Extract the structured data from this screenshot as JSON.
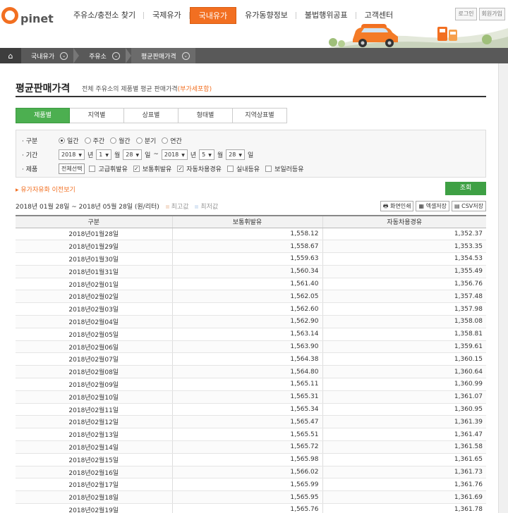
{
  "logo": {
    "text": "pinet"
  },
  "gnb": [
    "주유소/충전소 찾기",
    "국제유가",
    "국내유가",
    "유가동향정보",
    "불법행위공표",
    "고객센터"
  ],
  "util": {
    "login": "로그인",
    "join": "회원가입"
  },
  "breadcrumb": {
    "items": [
      "국내유가",
      "주유소",
      "평균판매가격"
    ]
  },
  "page": {
    "title": "평균판매가격",
    "desc": "전체 주유소의 제품별 평균 판매가격",
    "vat": "(부가세포함)"
  },
  "tabs": [
    "제품별",
    "지역별",
    "상표별",
    "형태별",
    "지역상표별"
  ],
  "search": {
    "row1_label": "구분",
    "period_options": [
      "일간",
      "주간",
      "월간",
      "분기",
      "연간"
    ],
    "row2_label": "기간",
    "start": {
      "year": "2018",
      "month": "1",
      "day": "28"
    },
    "end": {
      "year": "2018",
      "month": "5",
      "day": "28"
    },
    "units": {
      "y": "년",
      "m": "월",
      "d": "일",
      "tilde": "~"
    },
    "row3_label": "제품",
    "select_all": "전체선택",
    "products": [
      {
        "label": "고급휘발유",
        "checked": false
      },
      {
        "label": "보통휘발유",
        "checked": true
      },
      {
        "label": "자동차용경유",
        "checked": true
      },
      {
        "label": "실내등유",
        "checked": false
      },
      {
        "label": "보일러등유",
        "checked": false
      }
    ]
  },
  "history_link": "유가자유화 이전보기",
  "query_button": "조회",
  "range_text": "2018년 01월 28일 ~ 2018년 05월 28일 (원/리터)",
  "legend": {
    "max": "최고값",
    "min": "최저값"
  },
  "export": {
    "print": "화면인쇄",
    "excel": "엑셀저장",
    "csv": "CSV저장"
  },
  "table": {
    "headers": [
      "구분",
      "보통휘발유",
      "자동차용경유"
    ],
    "rows": [
      [
        "2018년01월28일",
        "1,558.12",
        "1,352.37"
      ],
      [
        "2018년01월29일",
        "1,558.67",
        "1,353.35"
      ],
      [
        "2018년01월30일",
        "1,559.63",
        "1,354.53"
      ],
      [
        "2018년01월31일",
        "1,560.34",
        "1,355.49"
      ],
      [
        "2018년02월01일",
        "1,561.40",
        "1,356.76"
      ],
      [
        "2018년02월02일",
        "1,562.05",
        "1,357.48"
      ],
      [
        "2018년02월03일",
        "1,562.60",
        "1,357.98"
      ],
      [
        "2018년02월04일",
        "1,562.90",
        "1,358.08"
      ],
      [
        "2018년02월05일",
        "1,563.14",
        "1,358.81"
      ],
      [
        "2018년02월06일",
        "1,563.90",
        "1,359.61"
      ],
      [
        "2018년02월07일",
        "1,564.38",
        "1,360.15"
      ],
      [
        "2018년02월08일",
        "1,564.80",
        "1,360.64"
      ],
      [
        "2018년02월09일",
        "1,565.11",
        "1,360.99"
      ],
      [
        "2018년02월10일",
        "1,565.31",
        "1,361.07"
      ],
      [
        "2018년02월11일",
        "1,565.34",
        "1,360.95"
      ],
      [
        "2018년02월12일",
        "1,565.47",
        "1,361.39"
      ],
      [
        "2018년02월13일",
        "1,565.51",
        "1,361.47"
      ],
      [
        "2018년02월14일",
        "1,565.72",
        "1,361.58"
      ],
      [
        "2018년02월15일",
        "1,565.98",
        "1,361.65"
      ],
      [
        "2018년02월16일",
        "1,566.02",
        "1,361.73"
      ],
      [
        "2018년02월17일",
        "1,565.99",
        "1,361.76"
      ],
      [
        "2018년02월18일",
        "1,565.95",
        "1,361.69"
      ],
      [
        "2018년02월19일",
        "1,565.76",
        "1,361.78"
      ]
    ]
  },
  "colors": {
    "accent": "#f26f21",
    "tab_active": "#4caf50",
    "query": "#3ea044",
    "crumb": "#595959"
  }
}
